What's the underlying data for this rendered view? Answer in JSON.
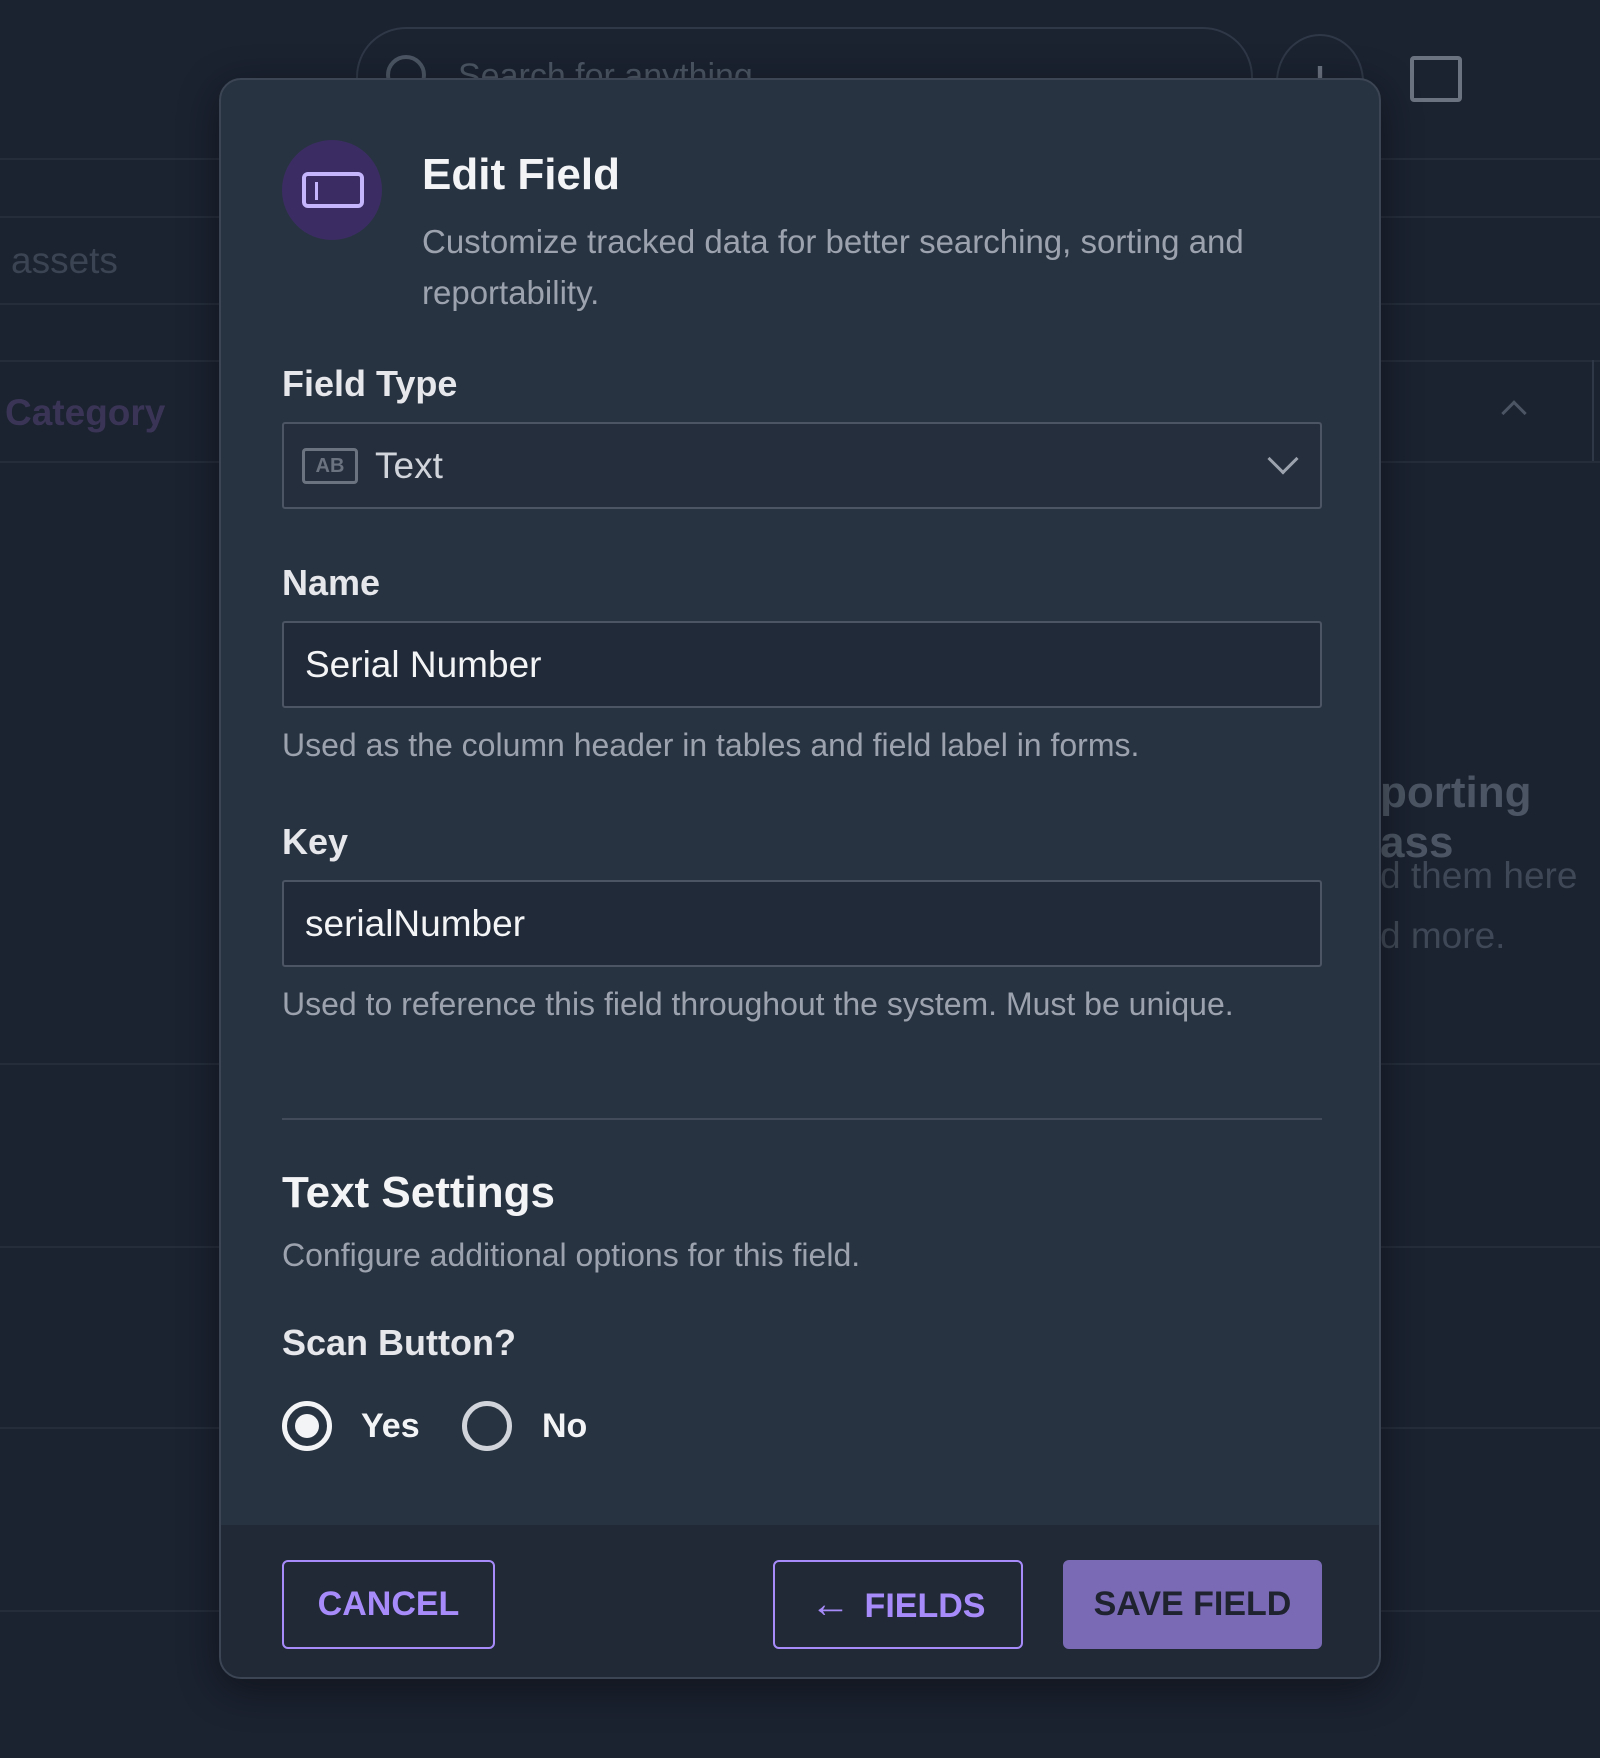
{
  "background": {
    "search_placeholder": "Search for anything",
    "assets_text": "assets",
    "category_header": "Category",
    "empty_title_fragment": "porting ass",
    "empty_line1_fragment": "d them here",
    "empty_line2_fragment": "d more."
  },
  "modal": {
    "icon": "text-field-icon",
    "title": "Edit Field",
    "description": "Customize tracked data for better searching, sorting and reportability.",
    "field_type": {
      "label": "Field Type",
      "value": "Text",
      "icon": "ab-text-icon"
    },
    "name": {
      "label": "Name",
      "value": "Serial Number",
      "help": "Used as the column header in tables and field label in forms."
    },
    "key": {
      "label": "Key",
      "value": "serialNumber",
      "help": "Used to reference this field throughout the system. Must be unique."
    },
    "settings": {
      "title": "Text Settings",
      "description": "Configure additional options for this field.",
      "scan_label": "Scan Button?",
      "options": [
        {
          "label": "Yes",
          "selected": true
        },
        {
          "label": "No",
          "selected": false
        }
      ]
    },
    "footer": {
      "cancel": "CANCEL",
      "fields": "FIELDS",
      "save": "SAVE FIELD"
    }
  },
  "colors": {
    "accent": "#a78bfa",
    "save_bg": "#7a6ab5",
    "modal_bg": "#283341",
    "page_bg": "#1b2230"
  }
}
